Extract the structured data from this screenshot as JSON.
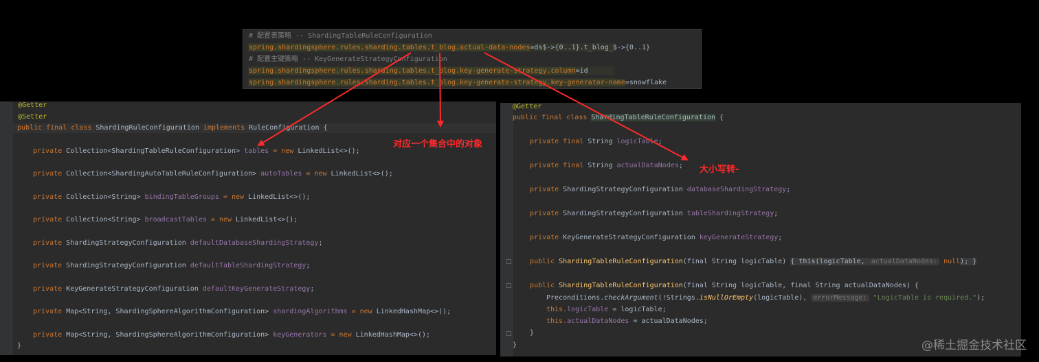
{
  "yaml": {
    "comment1": "# 配置表策略 -- ShardingTableRuleConfiguration",
    "line1_key": "spring.shardingsphere.rules.sharding.tables.t_blog.actual-data-nodes",
    "line1_val": "=ds$->{0..1}.t_blog_$->{0..1}",
    "comment2": "# 配置主键策略 -- KeyGenerateStrategyConfiguration",
    "line2_key": "spring.shardingsphere.rules.sharding.tables.t_blog.key-generate-strategy.column",
    "line2_val": "=id",
    "line3_key": "spring.shardingsphere.rules.sharding.tables.t_blog.key-generate-strategy.key-generator-name",
    "line3_val": "=snowflake"
  },
  "left": {
    "ann_getter": "@Getter",
    "ann_setter": "@Setter",
    "class_kw": "public final class ",
    "class_name": "ShardingRuleConfiguration",
    "implements_kw": " implements ",
    "iface": "RuleConfiguration {",
    "fields": [
      {
        "mod": "private ",
        "type": "Collection<ShardingTableRuleConfiguration> ",
        "name": "tables",
        "init_kw": " = new ",
        "init": "LinkedList<>();"
      },
      {
        "mod": "private ",
        "type": "Collection<ShardingAutoTableRuleConfiguration> ",
        "name": "autoTables",
        "init_kw": " = new ",
        "init": "LinkedList<>();"
      },
      {
        "mod": "private ",
        "type": "Collection<String> ",
        "name": "bindingTableGroups",
        "init_kw": " = new ",
        "init": "LinkedList<>();"
      },
      {
        "mod": "private ",
        "type": "Collection<String> ",
        "name": "broadcastTables",
        "init_kw": " = new ",
        "init": "LinkedList<>();"
      },
      {
        "mod": "private ",
        "type": "ShardingStrategyConfiguration ",
        "name": "defaultDatabaseShardingStrategy",
        "init_kw": "",
        "init": ";"
      },
      {
        "mod": "private ",
        "type": "ShardingStrategyConfiguration ",
        "name": "defaultTableShardingStrategy",
        "init_kw": "",
        "init": ";"
      },
      {
        "mod": "private ",
        "type": "KeyGenerateStrategyConfiguration ",
        "name": "defaultKeyGenerateStrategy",
        "init_kw": "",
        "init": ";"
      },
      {
        "mod": "private ",
        "type": "Map<String, ShardingSphereAlgorithmConfiguration> ",
        "name": "shardingAlgorithms",
        "init_kw": " = new ",
        "init": "LinkedHashMap<>();"
      },
      {
        "mod": "private ",
        "type": "Map<String, ShardingSphereAlgorithmConfiguration> ",
        "name": "keyGenerators",
        "init_kw": " = new ",
        "init": "LinkedHashMap<>();"
      }
    ],
    "close": "}"
  },
  "right": {
    "ann_getter": "@Getter",
    "class_kw": "public final class ",
    "class_name": "ShardingTableRuleConfiguration",
    "brace": " {",
    "fields": [
      {
        "mod": "private final ",
        "type": "String ",
        "name": "logicTable"
      },
      {
        "mod": "private final ",
        "type": "String ",
        "name": "actualDataNodes"
      },
      {
        "mod": "private ",
        "type": "ShardingStrategyConfiguration ",
        "name": "databaseShardingStrategy"
      },
      {
        "mod": "private ",
        "type": "ShardingStrategyConfiguration ",
        "name": "tableShardingStrategy"
      },
      {
        "mod": "private ",
        "type": "KeyGenerateStrategyConfiguration ",
        "name": "keyGenerateStrategy"
      }
    ],
    "ctor1_mod": "public ",
    "ctor1_name": "ShardingTableRuleConfiguration",
    "ctor1_params": "(final String logicTable) ",
    "ctor1_body_open": "{ this(logicTable, ",
    "ctor1_hint": "actualDataNodes:",
    "ctor1_null": " null",
    "ctor1_body_close": "); }",
    "ctor2_mod": "public ",
    "ctor2_name": "ShardingTableRuleConfiguration",
    "ctor2_params": "(final String logicTable, final String actualDataNodes) {",
    "ctor2_l1_a": "Preconditions.",
    "ctor2_l1_b": "checkArgument",
    "ctor2_l1_c": "(!Strings.",
    "ctor2_l1_d": "isNullOrEmpty",
    "ctor2_l1_e": "(logicTable), ",
    "ctor2_l1_hint": "errorMessage:",
    "ctor2_l1_str": " \"LogicTable is required.\"",
    "ctor2_l1_end": ");",
    "ctor2_l2_a": "this.",
    "ctor2_l2_b": "logicTable",
    "ctor2_l2_c": " = logicTable;",
    "ctor2_l3_a": "this.",
    "ctor2_l3_b": "actualDataNodes",
    "ctor2_l3_c": " = actualDataNodes;",
    "ctor2_close": "}",
    "close": "}"
  },
  "labels": {
    "collection_note": "对应一个集合中的对象",
    "case_note": "大小写转-"
  },
  "watermark": "@稀土掘金技术社区",
  "colors": {
    "background": "#000000",
    "editor_bg": "#2b2b2b",
    "keyword": "#cc7832",
    "field": "#9876aa",
    "annotation": "#bbb529",
    "arrow": "#ff2a2a"
  }
}
